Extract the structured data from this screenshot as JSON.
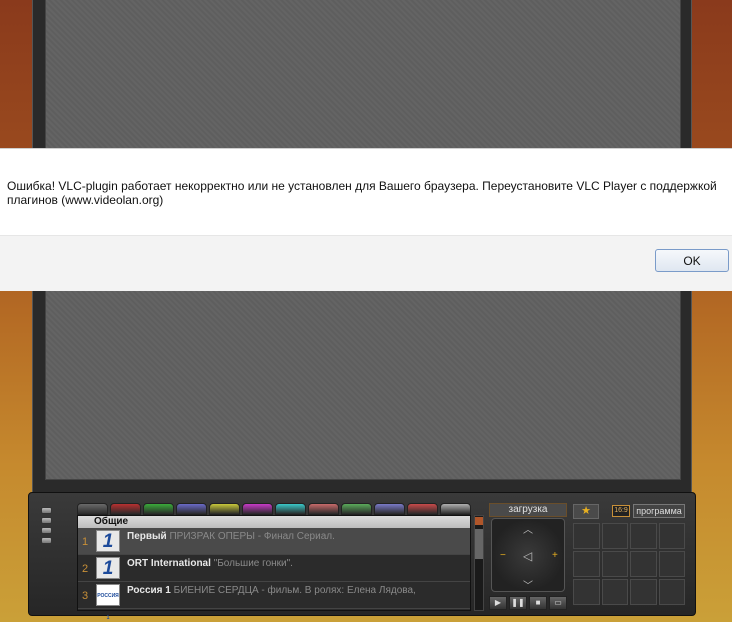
{
  "alert": {
    "message": "Ошибка! VLC-plugin работает некорректно или не установлен для Вашего браузера. Переустановите VLC Player с поддержкой плагинов (www.videolan.org)",
    "ok_label": "OK"
  },
  "channels": {
    "group_label": "Общие",
    "tab_colors": [
      "#6a6a6a",
      "#b83030",
      "#3aaa3a",
      "#6a6ac8",
      "#c8c83a",
      "#c83ac8",
      "#3ac8c8",
      "#c86a6a",
      "#5aaa5a",
      "#7a7ac8",
      "#c84a4a",
      "#b0b0b0"
    ],
    "rows": [
      {
        "number": "1",
        "logo": "1",
        "name": "Первый",
        "program": "ПРИЗРАК ОПЕРЫ - Финал Сериал."
      },
      {
        "number": "2",
        "logo": "1",
        "name": "ORT International",
        "program": "\"Большие гонки\"."
      },
      {
        "number": "3",
        "logo": "РОССИЯ 1",
        "name": "Россия 1",
        "program": "БИЕНИЕ СЕРДЦА - фильм. В ролях: Елена Лядова,"
      }
    ]
  },
  "controls": {
    "loading_label": "загрузка",
    "aspect_label": "16:9",
    "program_label": "программа",
    "star_glyph": "★",
    "dpad": {
      "up": "︿",
      "down": "﹀",
      "minus": "−",
      "plus": "+",
      "mute": "◁"
    },
    "transport": [
      "▶",
      "❚❚",
      "■",
      "▭"
    ]
  }
}
